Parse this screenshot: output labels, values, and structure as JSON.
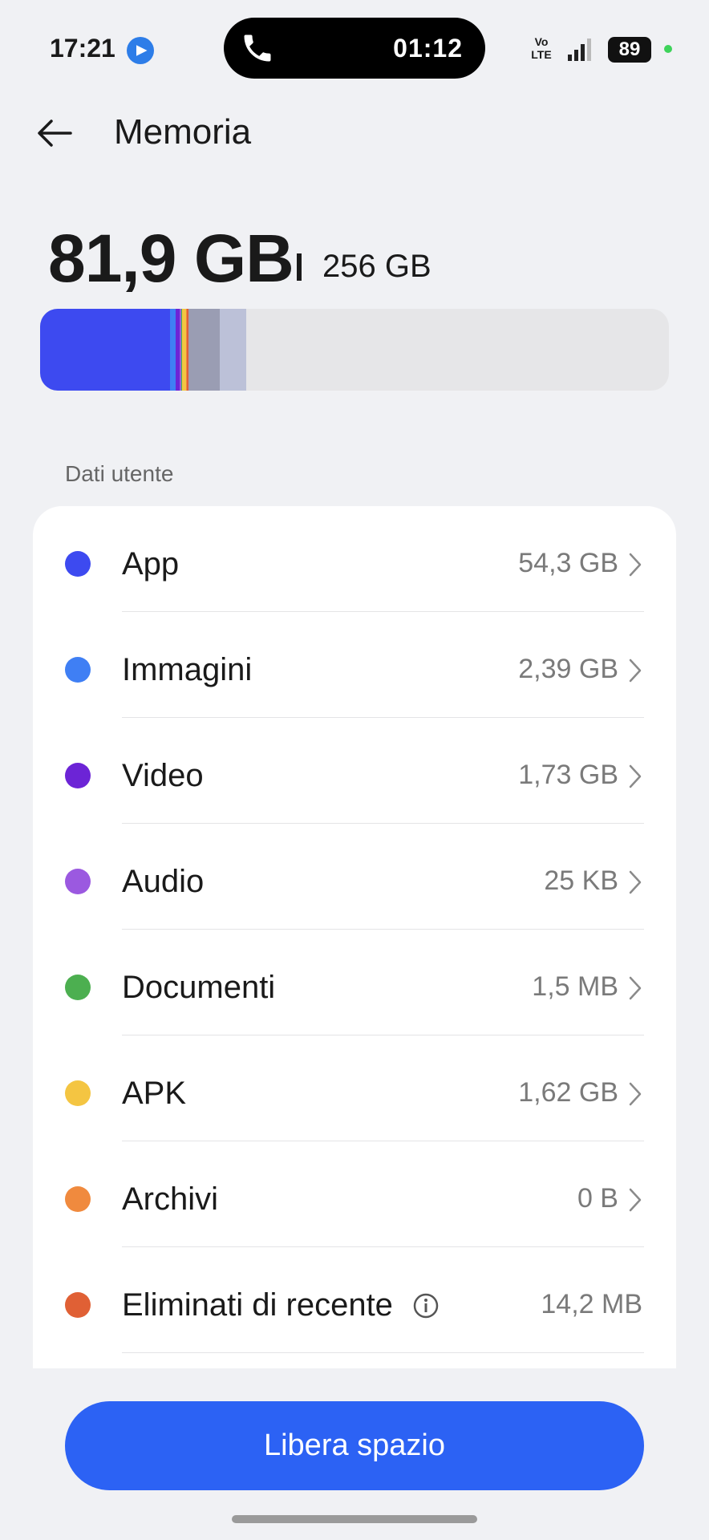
{
  "status_bar": {
    "time": "17:21",
    "call_timer": "01:12",
    "network_top": "Vo",
    "network_bottom": "LTE",
    "battery": "89"
  },
  "header": {
    "title": "Memoria"
  },
  "storage": {
    "used": "81,9 GB",
    "total": "256 GB",
    "breakdown_segments": [
      {
        "category": "App",
        "fraction": 0.206,
        "color": "#3d4af0"
      },
      {
        "category": "Immagini",
        "fraction": 0.009,
        "color": "#3f7ff4"
      },
      {
        "category": "Video",
        "fraction": 0.007,
        "color": "#6c24d6"
      },
      {
        "category": "Audio",
        "fraction": 0.002,
        "color": "#9b59e0"
      },
      {
        "category": "Documenti",
        "fraction": 0.002,
        "color": "#4caf50"
      },
      {
        "category": "APK",
        "fraction": 0.006,
        "color": "#f4c542"
      },
      {
        "category": "Archivi",
        "fraction": 0.002,
        "color": "#f08a3e"
      },
      {
        "category": "Eliminati di recente",
        "fraction": 0.002,
        "color": "#e06035"
      },
      {
        "category": "other",
        "fraction": 0.05,
        "color": "#9a9db3"
      },
      {
        "category": "system",
        "fraction": 0.042,
        "color": "#bcc1d8"
      }
    ]
  },
  "section": {
    "label": "Dati utente",
    "items": [
      {
        "label": "App",
        "value": "54,3 GB",
        "color": "#3d4af0"
      },
      {
        "label": "Immagini",
        "value": "2,39 GB",
        "color": "#3f7ff4"
      },
      {
        "label": "Video",
        "value": "1,73 GB",
        "color": "#6c24d6"
      },
      {
        "label": "Audio",
        "value": "25 KB",
        "color": "#9b59e0"
      },
      {
        "label": "Documenti",
        "value": "1,5 MB",
        "color": "#4caf50"
      },
      {
        "label": "APK",
        "value": "1,62 GB",
        "color": "#f4c542"
      },
      {
        "label": "Archivi",
        "value": "0 B",
        "color": "#f08a3e"
      },
      {
        "label": "Eliminati di recente",
        "value": "14,2 MB",
        "color": "#e06035"
      }
    ]
  },
  "actions": {
    "free_space": "Libera spazio"
  },
  "colors": {
    "accent": "#2c62f4",
    "background": "#f0f1f4",
    "card": "#ffffff"
  }
}
